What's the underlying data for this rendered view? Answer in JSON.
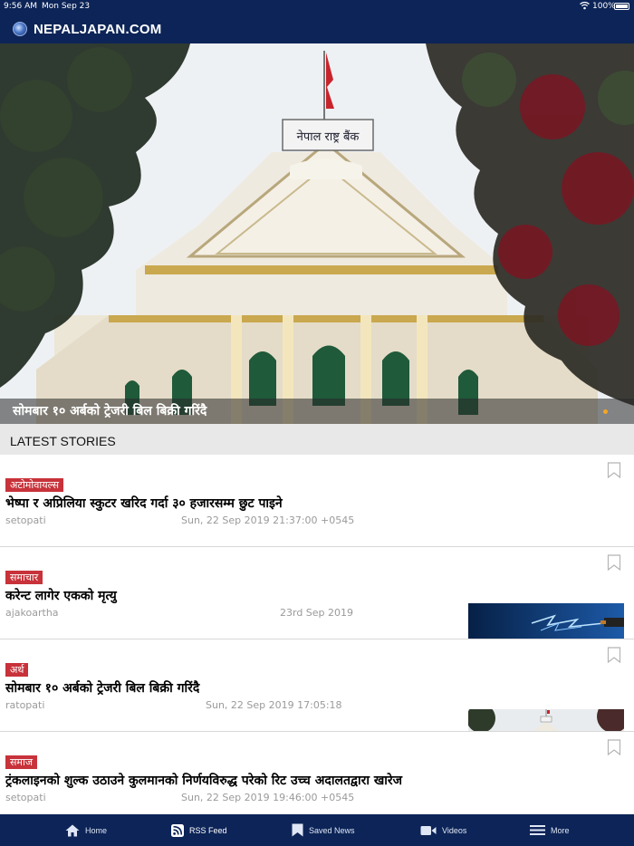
{
  "status_bar": {
    "time": "9:56 AM",
    "date": "Mon Sep 23",
    "battery": "100%"
  },
  "header": {
    "site_name": "NEPALJAPAN.COM"
  },
  "hero": {
    "caption": "सोमबार १० अर्बको ट्रेजरी बिल बिक्री गरिंदै",
    "sign_text": "नेपाल राष्ट्र बैंक"
  },
  "section": {
    "title": "LATEST STORIES"
  },
  "stories": [
    {
      "category": "अटोमोवायल्स",
      "headline": "भेष्पा र अप्रिलिया स्कुटर खरिद गर्दा ३० हजारसम्म छुट पाइने",
      "source": "setopati",
      "date": "Sun, 22 Sep 2019 21:37:00 +0545"
    },
    {
      "category": "समाचार",
      "headline": "करेन्ट लागेर एकको मृत्यु",
      "source": "ajakoartha",
      "date": "23rd Sep 2019"
    },
    {
      "category": "अर्थ",
      "headline": "सोमबार १० अर्बको ट्रेजरी बिल बिक्री गरिंदै",
      "source": "ratopati",
      "date": "Sun, 22 Sep 2019 17:05:18"
    },
    {
      "category": "समाज",
      "headline": "ट्रंकलाइनको शुल्क उठाउने कुलमानको निर्णयविरुद्ध परेको रिट उच्च अदालतद्वारा खारेज",
      "source": "setopati",
      "date": "Sun, 22 Sep 2019 19:46:00 +0545"
    }
  ],
  "tabs": [
    {
      "label": "Home",
      "icon": "home-icon"
    },
    {
      "label": "RSS Feed",
      "icon": "rss-icon"
    },
    {
      "label": "Saved News",
      "icon": "bookmark-icon"
    },
    {
      "label": "Videos",
      "icon": "video-camera-icon"
    },
    {
      "label": "More",
      "icon": "menu-icon"
    }
  ],
  "colors": {
    "header_bg": "#0c2457",
    "tag_bg": "#c8323a",
    "section_bg": "#e8e8e8",
    "active_dot": "#f5a623"
  }
}
